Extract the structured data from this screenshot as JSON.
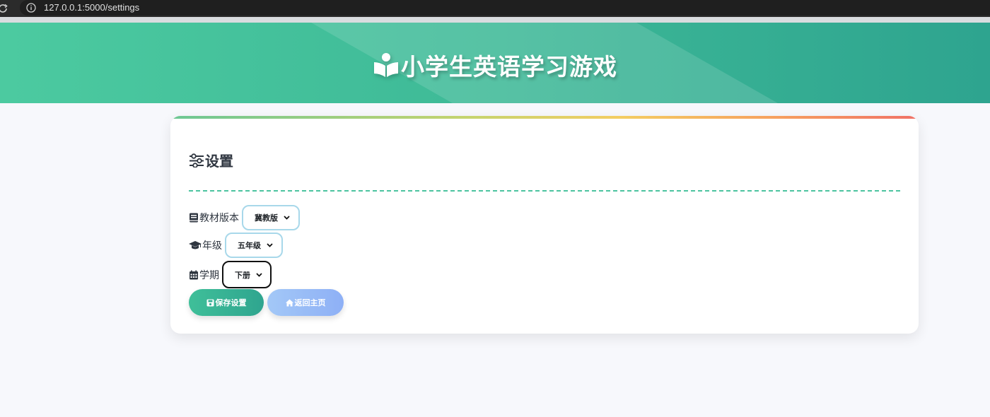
{
  "browser": {
    "url": "127.0.0.1:5000/settings",
    "reload_icon": "reload-icon",
    "info_icon": "info-icon"
  },
  "header": {
    "title": "小学生英语学习游戏",
    "icon": "book-reader-icon",
    "colors": {
      "gradient_start": "#4ccaa0",
      "gradient_end": "#2ea48f"
    }
  },
  "settings": {
    "heading": "设置",
    "heading_icon": "sliders-icon",
    "fields": {
      "textbook": {
        "label": "教材版本",
        "icon": "book-icon",
        "value": "冀教版"
      },
      "grade": {
        "label": "年级",
        "icon": "graduation-cap-icon",
        "value": "五年级"
      },
      "semester": {
        "label": "学期",
        "icon": "calendar-icon",
        "value": "下册"
      }
    },
    "buttons": {
      "save": {
        "label": "保存设置",
        "icon": "save-icon",
        "color": "#3fbf99"
      },
      "home": {
        "label": "返回主页",
        "icon": "home-icon",
        "color": "#a3c8f7"
      }
    }
  }
}
